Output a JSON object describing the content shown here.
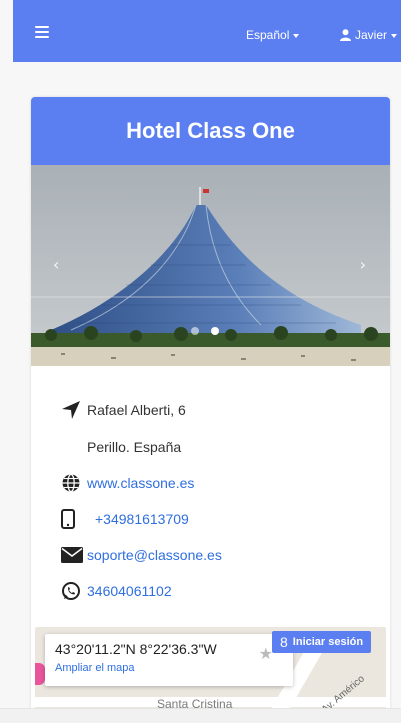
{
  "navbar": {
    "language_label": "Español",
    "user_name": "Javier",
    "color": "#5b7ff0"
  },
  "hotel": {
    "name": "Hotel Class One",
    "address_line1": "Rafael Alberti, 6",
    "address_line2": "Perillo. España",
    "website": "www.classone.es",
    "phone": "+34981613709",
    "email": "soporte@classone.es",
    "whatsapp": "34604061102"
  },
  "carousel": {
    "prev_arrow": "‹",
    "next_arrow": "›",
    "slide_count": 2,
    "active_index": 1
  },
  "map": {
    "coordinates": "43°20'11.2\"N 8°22'36.3\"W",
    "enlarge_link": "Ampliar el mapa",
    "signin_label": "Iniciar sesión",
    "place_label": "Santa Cristina",
    "road_label": "Av. Américo"
  },
  "icons": {
    "menu": "hamburger-menu-icon",
    "user": "user-icon",
    "location": "location-arrow-icon",
    "globe": "globe-icon",
    "phone": "mobile-phone-icon",
    "email": "envelope-icon",
    "whatsapp": "whatsapp-icon",
    "star": "star-icon"
  }
}
